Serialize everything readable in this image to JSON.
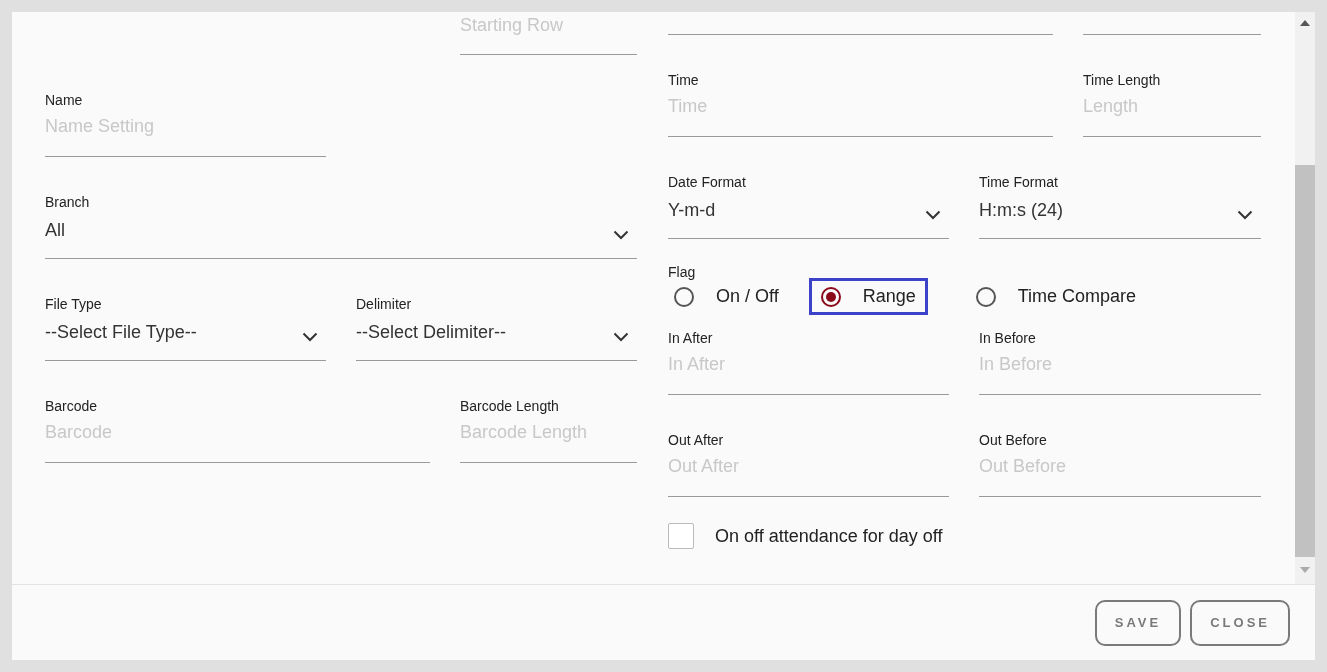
{
  "left": {
    "starting_row": {
      "placeholder": "Starting Row"
    },
    "name": {
      "label": "Name",
      "placeholder": "Name Setting"
    },
    "branch": {
      "label": "Branch",
      "value": "All"
    },
    "file_type": {
      "label": "File Type",
      "value": "--Select File Type--"
    },
    "delimiter": {
      "label": "Delimiter",
      "value": "--Select Delimiter--"
    },
    "barcode": {
      "label": "Barcode",
      "placeholder": "Barcode"
    },
    "barcode_length": {
      "label": "Barcode Length",
      "placeholder": "Barcode Length"
    }
  },
  "right": {
    "time": {
      "label": "Time",
      "placeholder": "Time"
    },
    "time_length": {
      "label": "Time Length",
      "placeholder": "Length"
    },
    "date_format": {
      "label": "Date Format",
      "value": "Y-m-d"
    },
    "time_format": {
      "label": "Time Format",
      "value": "H:m:s (24)"
    },
    "flag": {
      "label": "Flag",
      "options": [
        {
          "label": "On / Off",
          "selected": false,
          "focused": false
        },
        {
          "label": "Range",
          "selected": true,
          "focused": true
        },
        {
          "label": "Time Compare",
          "selected": false,
          "focused": false
        }
      ]
    },
    "in_after": {
      "label": "In After",
      "placeholder": "In After"
    },
    "in_before": {
      "label": "In Before",
      "placeholder": "In Before"
    },
    "out_after": {
      "label": "Out After",
      "placeholder": "Out After"
    },
    "out_before": {
      "label": "Out Before",
      "placeholder": "Out Before"
    },
    "day_off": {
      "label": "On off attendance for day off",
      "checked": false
    }
  },
  "buttons": [
    {
      "label": "SAVE"
    },
    {
      "label": "CLOSE"
    }
  ]
}
